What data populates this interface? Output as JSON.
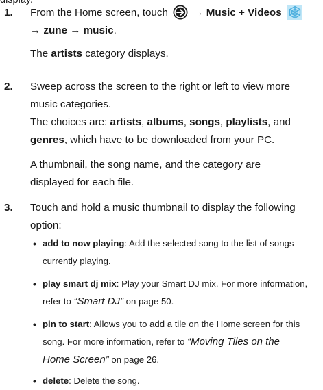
{
  "cutoff_text": "display.",
  "steps": [
    {
      "number": "1.",
      "parts": {
        "p1": "From the Home screen, touch ",
        "arrow": " → ",
        "music_videos": "Music + Videos",
        "arrow2": "→ ",
        "zune": "zune",
        "arrow3": " → ",
        "music": "music",
        "period": "."
      },
      "result_b": "artists",
      "result_rest": " category displays.",
      "result_pre": "The "
    },
    {
      "number": "2.",
      "line1": "Sweep across the screen to the right or left to view more",
      "line2": "music categories.",
      "choices_pre": "The choices are: ",
      "choices": [
        "artists",
        "albums",
        "songs",
        "playlists"
      ],
      "choices_and": ", and",
      "genres": "genres",
      "genres_rest": ", which have to be downloaded from your PC.",
      "thumb_line1": "A thumbnail, the song name, and the category are",
      "thumb_line2": "displayed for each file."
    },
    {
      "number": "3.",
      "line1": "Touch and hold a music thumbnail to display the following",
      "line2": "option:",
      "bullets": [
        {
          "term": "add to now playing",
          "desc1": ": Add the selected song to the list of songs",
          "desc2": "currently playing."
        },
        {
          "term": "play smart dj mix",
          "desc1": ": Play your Smart DJ mix. For more information,",
          "desc2_pre": "refer to ",
          "ref": "“Smart DJ”",
          "desc2_post": " on page 50."
        },
        {
          "term": "pin to start",
          "desc1": ": Allows you to add a tile on the Home screen for this",
          "desc2_pre": "song. For more information, refer to ",
          "ref1": "“Moving Tiles on the",
          "ref2": "Home Screen”",
          "desc3_post": " on page 26."
        },
        {
          "term": "delete",
          "desc1": ": Delete the song."
        }
      ]
    }
  ],
  "icons": {
    "start_arrow": "circle-arrow-right-icon",
    "music_videos": "zune-music-videos-icon"
  },
  "colors": {
    "icon_dark": "#1a1a1a",
    "zune_icon": "#6fc7ee"
  }
}
